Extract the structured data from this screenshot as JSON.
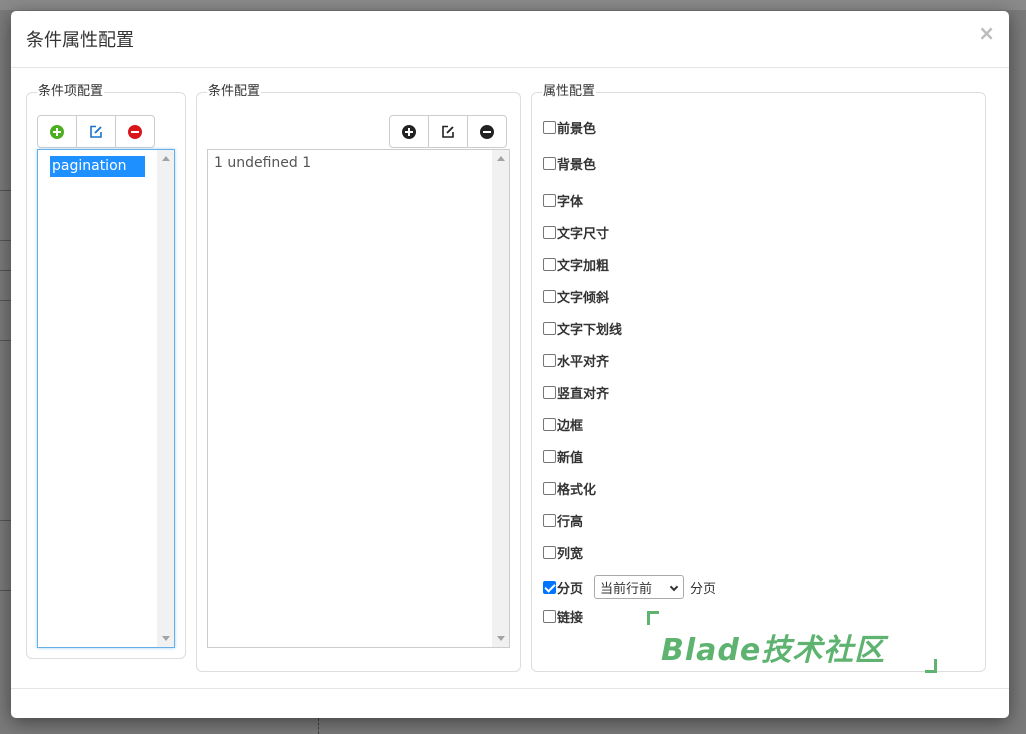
{
  "modal": {
    "title": "条件属性配置",
    "close": "×"
  },
  "condition_items": {
    "legend": "条件项配置",
    "items": [
      "pagination"
    ],
    "selected": "pagination"
  },
  "conditions": {
    "legend": "条件配置",
    "items": [
      "1 undefined 1"
    ]
  },
  "attributes": {
    "legend": "属性配置",
    "items": [
      {
        "label": "前景色",
        "checked": false
      },
      {
        "label": "背景色",
        "checked": false
      },
      {
        "label": "字体",
        "checked": false
      },
      {
        "label": "文字尺寸",
        "checked": false
      },
      {
        "label": "文字加粗",
        "checked": false
      },
      {
        "label": "文字倾斜",
        "checked": false
      },
      {
        "label": "文字下划线",
        "checked": false
      },
      {
        "label": "水平对齐",
        "checked": false
      },
      {
        "label": "竖直对齐",
        "checked": false
      },
      {
        "label": "边框",
        "checked": false
      },
      {
        "label": "新值",
        "checked": false
      },
      {
        "label": "格式化",
        "checked": false
      },
      {
        "label": "行高",
        "checked": false
      },
      {
        "label": "列宽",
        "checked": false
      },
      {
        "label": "分页",
        "checked": true
      },
      {
        "label": "链接",
        "checked": false
      }
    ],
    "pagination_select": "当前行前",
    "pagination_suffix": "分页"
  },
  "icons": {
    "add": "plus-circle-icon",
    "edit": "edit-icon",
    "remove": "minus-circle-icon"
  },
  "colors": {
    "add_green": "#4caf20",
    "edit_blue": "#1a73c8",
    "remove_red": "#d9161c",
    "selection": "#1e90ff",
    "watermark": "#5db36f"
  },
  "watermark": {
    "text": "Blade技术社区"
  }
}
